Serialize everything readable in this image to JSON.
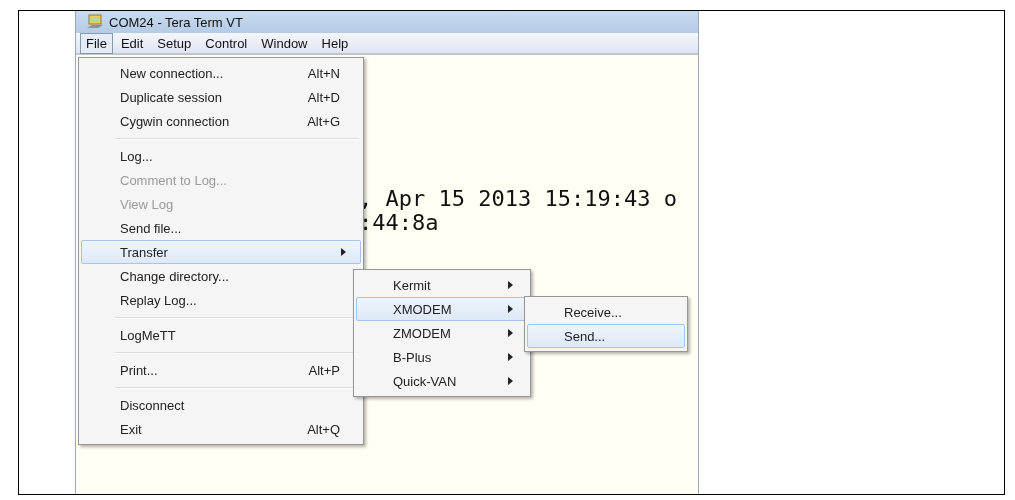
{
  "window": {
    "title": "COM24 - Tera Term VT"
  },
  "menu_bar": [
    {
      "label": "File",
      "selected": true
    },
    {
      "label": "Edit",
      "selected": false
    },
    {
      "label": "Setup",
      "selected": false
    },
    {
      "label": "Control",
      "selected": false
    },
    {
      "label": "Window",
      "selected": false
    },
    {
      "label": "Help",
      "selected": false
    }
  ],
  "terminal": {
    "lines": [
      ", Apr 15 2013 15:19:43 o",
      ":44:8a"
    ]
  },
  "file_menu": {
    "items": [
      {
        "kind": "item",
        "label": "New connection...",
        "shortcut": "Alt+N",
        "disabled": false,
        "selected": false,
        "has_submenu": false
      },
      {
        "kind": "item",
        "label": "Duplicate session",
        "shortcut": "Alt+D",
        "disabled": false,
        "selected": false,
        "has_submenu": false
      },
      {
        "kind": "item",
        "label": "Cygwin connection",
        "shortcut": "Alt+G",
        "disabled": false,
        "selected": false,
        "has_submenu": false
      },
      {
        "kind": "separator"
      },
      {
        "kind": "item",
        "label": "Log...",
        "disabled": false,
        "selected": false,
        "has_submenu": false
      },
      {
        "kind": "item",
        "label": "Comment to Log...",
        "disabled": true,
        "selected": false,
        "has_submenu": false
      },
      {
        "kind": "item",
        "label": "View Log",
        "disabled": true,
        "selected": false,
        "has_submenu": false
      },
      {
        "kind": "item",
        "label": "Send file...",
        "disabled": false,
        "selected": false,
        "has_submenu": false
      },
      {
        "kind": "item",
        "label": "Transfer",
        "disabled": false,
        "selected": true,
        "has_submenu": true
      },
      {
        "kind": "item",
        "label": "Change directory...",
        "disabled": false,
        "selected": false,
        "has_submenu": false
      },
      {
        "kind": "item",
        "label": "Replay Log...",
        "disabled": false,
        "selected": false,
        "has_submenu": false
      },
      {
        "kind": "separator"
      },
      {
        "kind": "item",
        "label": "LogMeTT",
        "disabled": false,
        "selected": false,
        "has_submenu": false
      },
      {
        "kind": "separator"
      },
      {
        "kind": "item",
        "label": "Print...",
        "shortcut": "Alt+P",
        "disabled": false,
        "selected": false,
        "has_submenu": false
      },
      {
        "kind": "separator"
      },
      {
        "kind": "item",
        "label": "Disconnect",
        "disabled": false,
        "selected": false,
        "has_submenu": false
      },
      {
        "kind": "item",
        "label": "Exit",
        "shortcut": "Alt+Q",
        "disabled": false,
        "selected": false,
        "has_submenu": false
      }
    ]
  },
  "transfer_menu": {
    "items": [
      {
        "kind": "item",
        "label": "Kermit",
        "disabled": false,
        "selected": false,
        "has_submenu": true
      },
      {
        "kind": "item",
        "label": "XMODEM",
        "disabled": false,
        "selected": true,
        "has_submenu": true
      },
      {
        "kind": "item",
        "label": "ZMODEM",
        "disabled": false,
        "selected": false,
        "has_submenu": true
      },
      {
        "kind": "item",
        "label": "B-Plus",
        "disabled": false,
        "selected": false,
        "has_submenu": true
      },
      {
        "kind": "item",
        "label": "Quick-VAN",
        "disabled": false,
        "selected": false,
        "has_submenu": true
      }
    ]
  },
  "xmodem_menu": {
    "items": [
      {
        "kind": "item",
        "label": "Receive...",
        "disabled": false,
        "selected": false,
        "has_submenu": false
      },
      {
        "kind": "item",
        "label": "Send...",
        "disabled": false,
        "selected": true,
        "has_submenu": false
      }
    ]
  }
}
